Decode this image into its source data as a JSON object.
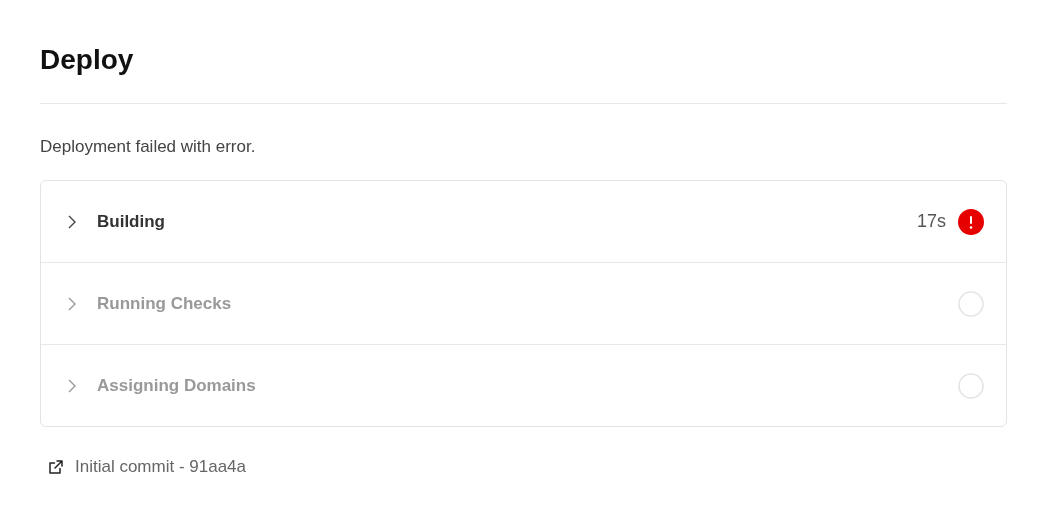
{
  "title": "Deploy",
  "message": "Deployment failed with error.",
  "steps": [
    {
      "label": "Building",
      "active": true,
      "duration": "17s",
      "kind": "error"
    },
    {
      "label": "Running Checks",
      "active": false,
      "kind": "pending"
    },
    {
      "label": "Assigning Domains",
      "active": false,
      "kind": "pending"
    }
  ],
  "commit_link": "Initial commit - 91aa4a"
}
